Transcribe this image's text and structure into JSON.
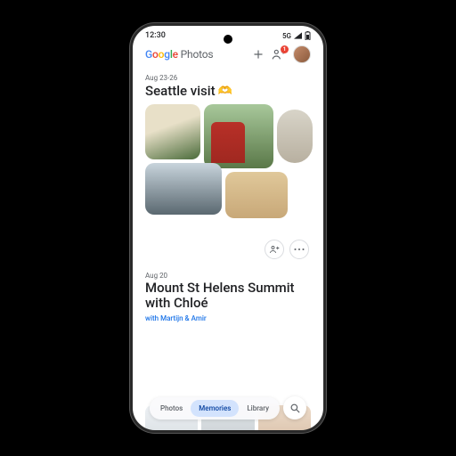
{
  "statusbar": {
    "time": "12:30",
    "signal": "5G"
  },
  "header": {
    "logo_parts": [
      "G",
      "o",
      "o",
      "g",
      "l",
      "e",
      " Photos"
    ],
    "share_badge": "1"
  },
  "memories": [
    {
      "date": "Aug 23-26",
      "title": "Seattle visit",
      "emoji": "🫶"
    },
    {
      "date": "Aug 20",
      "title": "Mount St Helens Summit with Chloé",
      "subtitle": "with Martijn & Amir"
    }
  ],
  "bottombar": {
    "tabs": [
      "Photos",
      "Memories",
      "Library"
    ],
    "active_index": 1
  }
}
